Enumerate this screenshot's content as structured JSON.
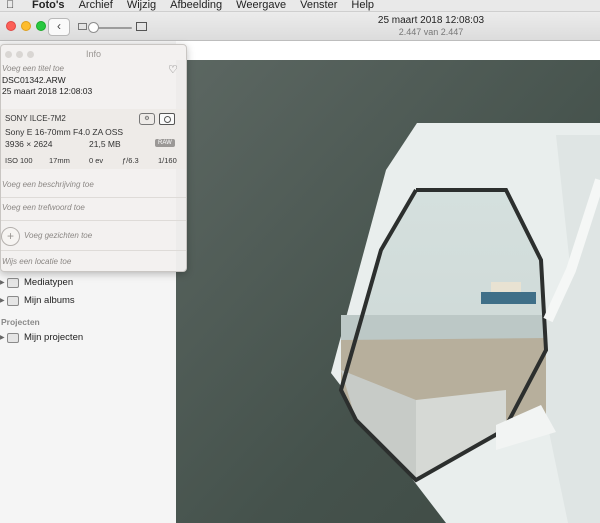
{
  "menubar": {
    "items": [
      "Foto's",
      "Archief",
      "Wijzig",
      "Afbeelding",
      "Weergave",
      "Venster",
      "Help"
    ]
  },
  "toolbar": {
    "back_icon": "‹",
    "date": "25 maart 2018 12:08:03",
    "count": "2.447 van 2.447"
  },
  "info": {
    "window_title": "Info",
    "title_placeholder": "Voeg een titel toe",
    "filename": "DSC01342.ARW",
    "datetime": "25 maart 2018   12:08:03",
    "camera": {
      "model": "SONY ILCE-7M2",
      "lens": "Sony E 16-70mm F4.0 ZA OSS",
      "resolution": "3936 × 2624",
      "filesize": "21,5 MB",
      "format": "RAW"
    },
    "exif": {
      "iso": "ISO 100",
      "focal": "17mm",
      "ev": "0 ev",
      "aperture": "ƒ/6.3",
      "shutter": "1/160"
    },
    "description_placeholder": "Voeg een beschrijving toe",
    "keyword_placeholder": "Voeg een trefwoord toe",
    "faces_label": "Voeg gezichten toe",
    "location_placeholder": "Wijs een locatie toe"
  },
  "sidebar": {
    "items": [
      {
        "label": "Mediatypen"
      },
      {
        "label": "Mijn albums"
      }
    ],
    "projects_header": "Projecten",
    "projects_item": "Mijn projecten"
  }
}
